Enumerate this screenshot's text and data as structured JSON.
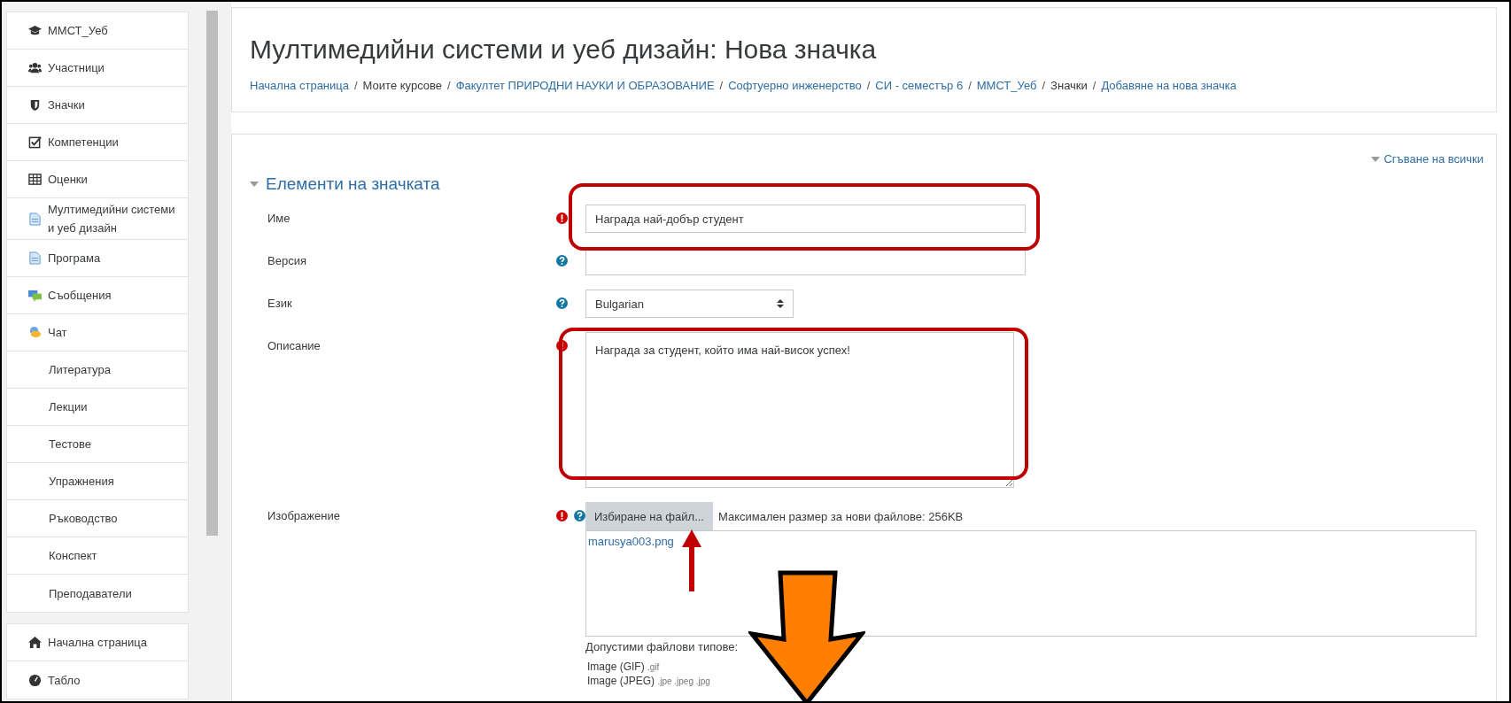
{
  "sidebar": {
    "groups": [
      {
        "items": [
          {
            "label": "ММСТ_Уеб"
          },
          {
            "label": "Участници"
          },
          {
            "label": "Значки"
          },
          {
            "label": "Компетенции"
          },
          {
            "label": "Оценки"
          },
          {
            "label": "Мултимедийни системи и уеб дизайн"
          },
          {
            "label": "Програма"
          },
          {
            "label": "Съобщения"
          },
          {
            "label": "Чат"
          },
          {
            "label": "Литература"
          },
          {
            "label": "Лекции"
          },
          {
            "label": "Тестове"
          },
          {
            "label": "Упражнения"
          },
          {
            "label": "Ръководство"
          },
          {
            "label": "Конспект"
          },
          {
            "label": "Преподаватели"
          }
        ]
      },
      {
        "items": [
          {
            "label": "Начална страница"
          },
          {
            "label": "Табло"
          }
        ]
      }
    ]
  },
  "header": {
    "title": "Мултимедийни системи и уеб дизайн: Нова значка",
    "breadcrumb": [
      {
        "label": "Начална страница",
        "link": true
      },
      {
        "separator": "/",
        "label": "Моите курсове",
        "link": false
      },
      {
        "separator": "/",
        "label": "Факултет ПРИРОДНИ НАУКИ И ОБРАЗОВАНИЕ",
        "link": true
      },
      {
        "separator": "/",
        "label": "Софтуерно инженерство",
        "link": true
      },
      {
        "separator": "/",
        "label": "СИ - семестър 6",
        "link": true
      },
      {
        "separator": "/",
        "label": "ММСТ_Уеб",
        "link": true
      },
      {
        "separator": "/",
        "label": "Значки",
        "link": false
      },
      {
        "separator": "/",
        "label": "Добавяне на нова значка",
        "link": true
      }
    ]
  },
  "form": {
    "collapse_all": "Сгъване на всички",
    "section": {
      "title": "Елементи на значката",
      "expanded": true
    },
    "fields": [
      {
        "kind": "text",
        "label": "Име",
        "value": "Награда най-добър студент",
        "required": true,
        "help": false
      },
      {
        "kind": "text",
        "label": "Версия",
        "required": false,
        "help": true
      },
      {
        "kind": "select",
        "label": "Език",
        "value": "Bulgarian",
        "required": false,
        "help": true
      },
      {
        "kind": "textarea",
        "label": "Описание",
        "value": "Награда за студент, който има най-висок успех!",
        "required": true,
        "help": false
      },
      {
        "kind": "file",
        "label": "Изображение",
        "required": true,
        "help": true,
        "button": "Избиране на файл...",
        "max_size": "Максимален размер за нови файлове: 256KB",
        "files": [
          "marusya003.png"
        ],
        "accepted_label": "Допустими файлови типове:",
        "accepted": [
          {
            "name": "Image (GIF)",
            "ext": ".gif"
          },
          {
            "name": "Image (JPEG)",
            "ext": ".jpe .jpeg .jpg"
          }
        ]
      }
    ]
  }
}
